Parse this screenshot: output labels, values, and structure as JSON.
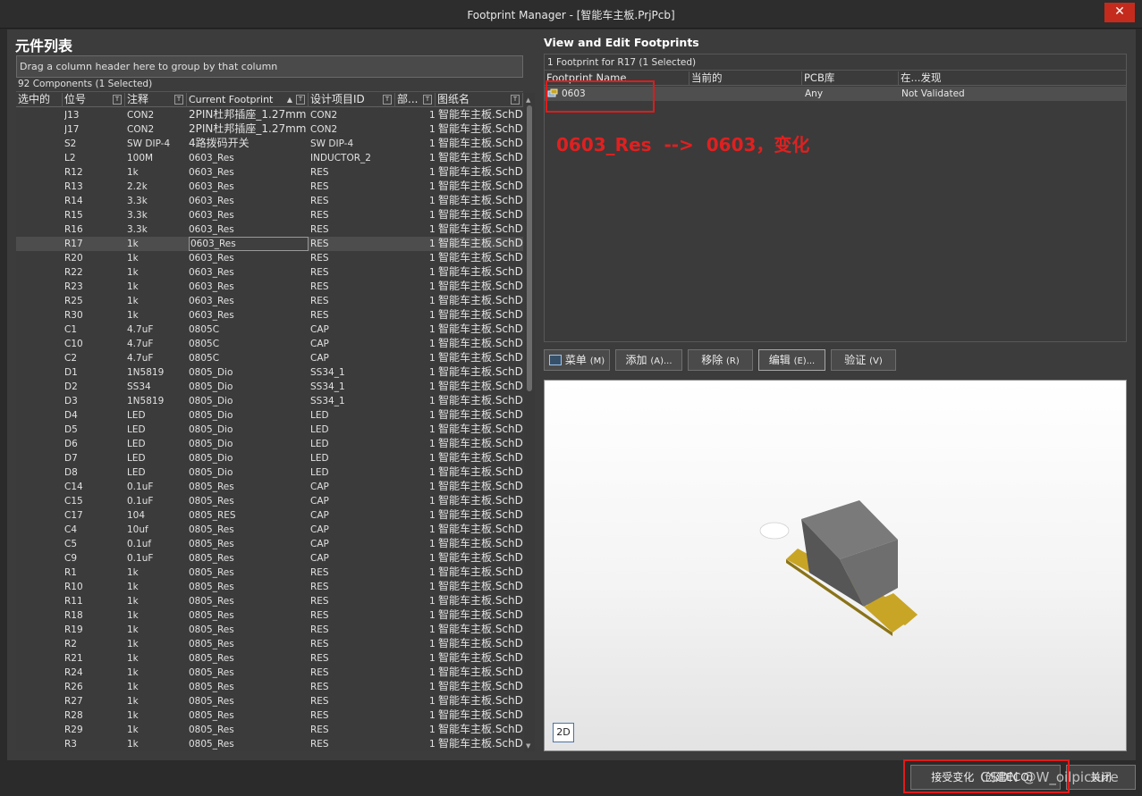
{
  "window": {
    "title": "Footprint Manager - [智能车主板.PrjPcb]",
    "close_glyph": "✕"
  },
  "left": {
    "title": "元件列表",
    "group_hint": "Drag a column header here to group by that column",
    "count": "92 Components (1 Selected)",
    "columns": [
      "选中的",
      "位号",
      "注释",
      "Current Footprint",
      "设计项目ID",
      "部...",
      "图纸名"
    ],
    "filter_glyph": "T",
    "sort_glyph": "▲",
    "rows": [
      [
        "J13",
        "CON2",
        "2PIN杜邦插座_1.27mm",
        "CON2",
        "1",
        "智能车主板.SchD"
      ],
      [
        "J17",
        "CON2",
        "2PIN杜邦插座_1.27mm",
        "CON2",
        "1",
        "智能车主板.SchD"
      ],
      [
        "S2",
        "SW DIP-4",
        "4路拨码开关",
        "SW DIP-4",
        "1",
        "智能车主板.SchD"
      ],
      [
        "L2",
        "100M",
        "0603_Res",
        "INDUCTOR_2",
        "1",
        "智能车主板.SchD"
      ],
      [
        "R12",
        "1k",
        "0603_Res",
        "RES",
        "1",
        "智能车主板.SchD"
      ],
      [
        "R13",
        "2.2k",
        "0603_Res",
        "RES",
        "1",
        "智能车主板.SchD"
      ],
      [
        "R14",
        "3.3k",
        "0603_Res",
        "RES",
        "1",
        "智能车主板.SchD"
      ],
      [
        "R15",
        "3.3k",
        "0603_Res",
        "RES",
        "1",
        "智能车主板.SchD"
      ],
      [
        "R16",
        "3.3k",
        "0603_Res",
        "RES",
        "1",
        "智能车主板.SchD"
      ],
      [
        "R17",
        "1k",
        "0603_Res",
        "RES",
        "1",
        "智能车主板.SchD"
      ],
      [
        "R20",
        "1k",
        "0603_Res",
        "RES",
        "1",
        "智能车主板.SchD"
      ],
      [
        "R22",
        "1k",
        "0603_Res",
        "RES",
        "1",
        "智能车主板.SchD"
      ],
      [
        "R23",
        "1k",
        "0603_Res",
        "RES",
        "1",
        "智能车主板.SchD"
      ],
      [
        "R25",
        "1k",
        "0603_Res",
        "RES",
        "1",
        "智能车主板.SchD"
      ],
      [
        "R30",
        "1k",
        "0603_Res",
        "RES",
        "1",
        "智能车主板.SchD"
      ],
      [
        "C1",
        "4.7uF",
        "0805C",
        "CAP",
        "1",
        "智能车主板.SchD"
      ],
      [
        "C10",
        "4.7uF",
        "0805C",
        "CAP",
        "1",
        "智能车主板.SchD"
      ],
      [
        "C2",
        "4.7uF",
        "0805C",
        "CAP",
        "1",
        "智能车主板.SchD"
      ],
      [
        "D1",
        "1N5819",
        "0805_Dio",
        "SS34_1",
        "1",
        "智能车主板.SchD"
      ],
      [
        "D2",
        "SS34",
        "0805_Dio",
        "SS34_1",
        "1",
        "智能车主板.SchD"
      ],
      [
        "D3",
        "1N5819",
        "0805_Dio",
        "SS34_1",
        "1",
        "智能车主板.SchD"
      ],
      [
        "D4",
        "LED",
        "0805_Dio",
        "LED",
        "1",
        "智能车主板.SchD"
      ],
      [
        "D5",
        "LED",
        "0805_Dio",
        "LED",
        "1",
        "智能车主板.SchD"
      ],
      [
        "D6",
        "LED",
        "0805_Dio",
        "LED",
        "1",
        "智能车主板.SchD"
      ],
      [
        "D7",
        "LED",
        "0805_Dio",
        "LED",
        "1",
        "智能车主板.SchD"
      ],
      [
        "D8",
        "LED",
        "0805_Dio",
        "LED",
        "1",
        "智能车主板.SchD"
      ],
      [
        "C14",
        "0.1uF",
        "0805_Res",
        "CAP",
        "1",
        "智能车主板.SchD"
      ],
      [
        "C15",
        "0.1uF",
        "0805_Res",
        "CAP",
        "1",
        "智能车主板.SchD"
      ],
      [
        "C17",
        "104",
        "0805_RES",
        "CAP",
        "1",
        "智能车主板.SchD"
      ],
      [
        "C4",
        "10uf",
        "0805_Res",
        "CAP",
        "1",
        "智能车主板.SchD"
      ],
      [
        "C5",
        "0.1uf",
        "0805_Res",
        "CAP",
        "1",
        "智能车主板.SchD"
      ],
      [
        "C9",
        "0.1uF",
        "0805_Res",
        "CAP",
        "1",
        "智能车主板.SchD"
      ],
      [
        "R1",
        "1k",
        "0805_Res",
        "RES",
        "1",
        "智能车主板.SchD"
      ],
      [
        "R10",
        "1k",
        "0805_Res",
        "RES",
        "1",
        "智能车主板.SchD"
      ],
      [
        "R11",
        "1k",
        "0805_Res",
        "RES",
        "1",
        "智能车主板.SchD"
      ],
      [
        "R18",
        "1k",
        "0805_Res",
        "RES",
        "1",
        "智能车主板.SchD"
      ],
      [
        "R19",
        "1k",
        "0805_Res",
        "RES",
        "1",
        "智能车主板.SchD"
      ],
      [
        "R2",
        "1k",
        "0805_Res",
        "RES",
        "1",
        "智能车主板.SchD"
      ],
      [
        "R21",
        "1k",
        "0805_Res",
        "RES",
        "1",
        "智能车主板.SchD"
      ],
      [
        "R24",
        "1k",
        "0805_Res",
        "RES",
        "1",
        "智能车主板.SchD"
      ],
      [
        "R26",
        "1k",
        "0805_Res",
        "RES",
        "1",
        "智能车主板.SchD"
      ],
      [
        "R27",
        "1k",
        "0805_Res",
        "RES",
        "1",
        "智能车主板.SchD"
      ],
      [
        "R28",
        "1k",
        "0805_Res",
        "RES",
        "1",
        "智能车主板.SchD"
      ],
      [
        "R29",
        "1k",
        "0805_Res",
        "RES",
        "1",
        "智能车主板.SchD"
      ],
      [
        "R3",
        "1k",
        "0805_Res",
        "RES",
        "1",
        "智能车主板.SchD"
      ]
    ],
    "selected_designator": "R17",
    "scroll_up_glyph": "▲",
    "scroll_down_glyph": "▼"
  },
  "right": {
    "title": "View and Edit Footprints",
    "info": "1 Footprint for R17 (1 Selected)",
    "columns": [
      "Footprint Name",
      "当前的",
      "PCB库",
      "在...发现"
    ],
    "footprint": {
      "name": "0603",
      "current": "",
      "pcb_lib": "Any",
      "found_in": "Not Validated"
    },
    "annotation": "0603_Res  -->  0603，变化",
    "buttons": {
      "menu": "菜单",
      "menu_key": "(M)",
      "add": "添加",
      "add_key": "(A)...",
      "remove": "移除",
      "remove_key": "(R)",
      "edit": "编辑",
      "edit_key": "(E)...",
      "validate": "验证",
      "validate_key": "(V)"
    },
    "view_mode": "2D"
  },
  "bottom": {
    "accept": "接受变化（创建ECO）",
    "close": "关闭",
    "watermark": "CSDN @W_oilpicture"
  },
  "colors": {
    "accent_red": "#e01b1b",
    "pad_gold": "#c9a526",
    "body_gray": "#6e6e6e"
  }
}
